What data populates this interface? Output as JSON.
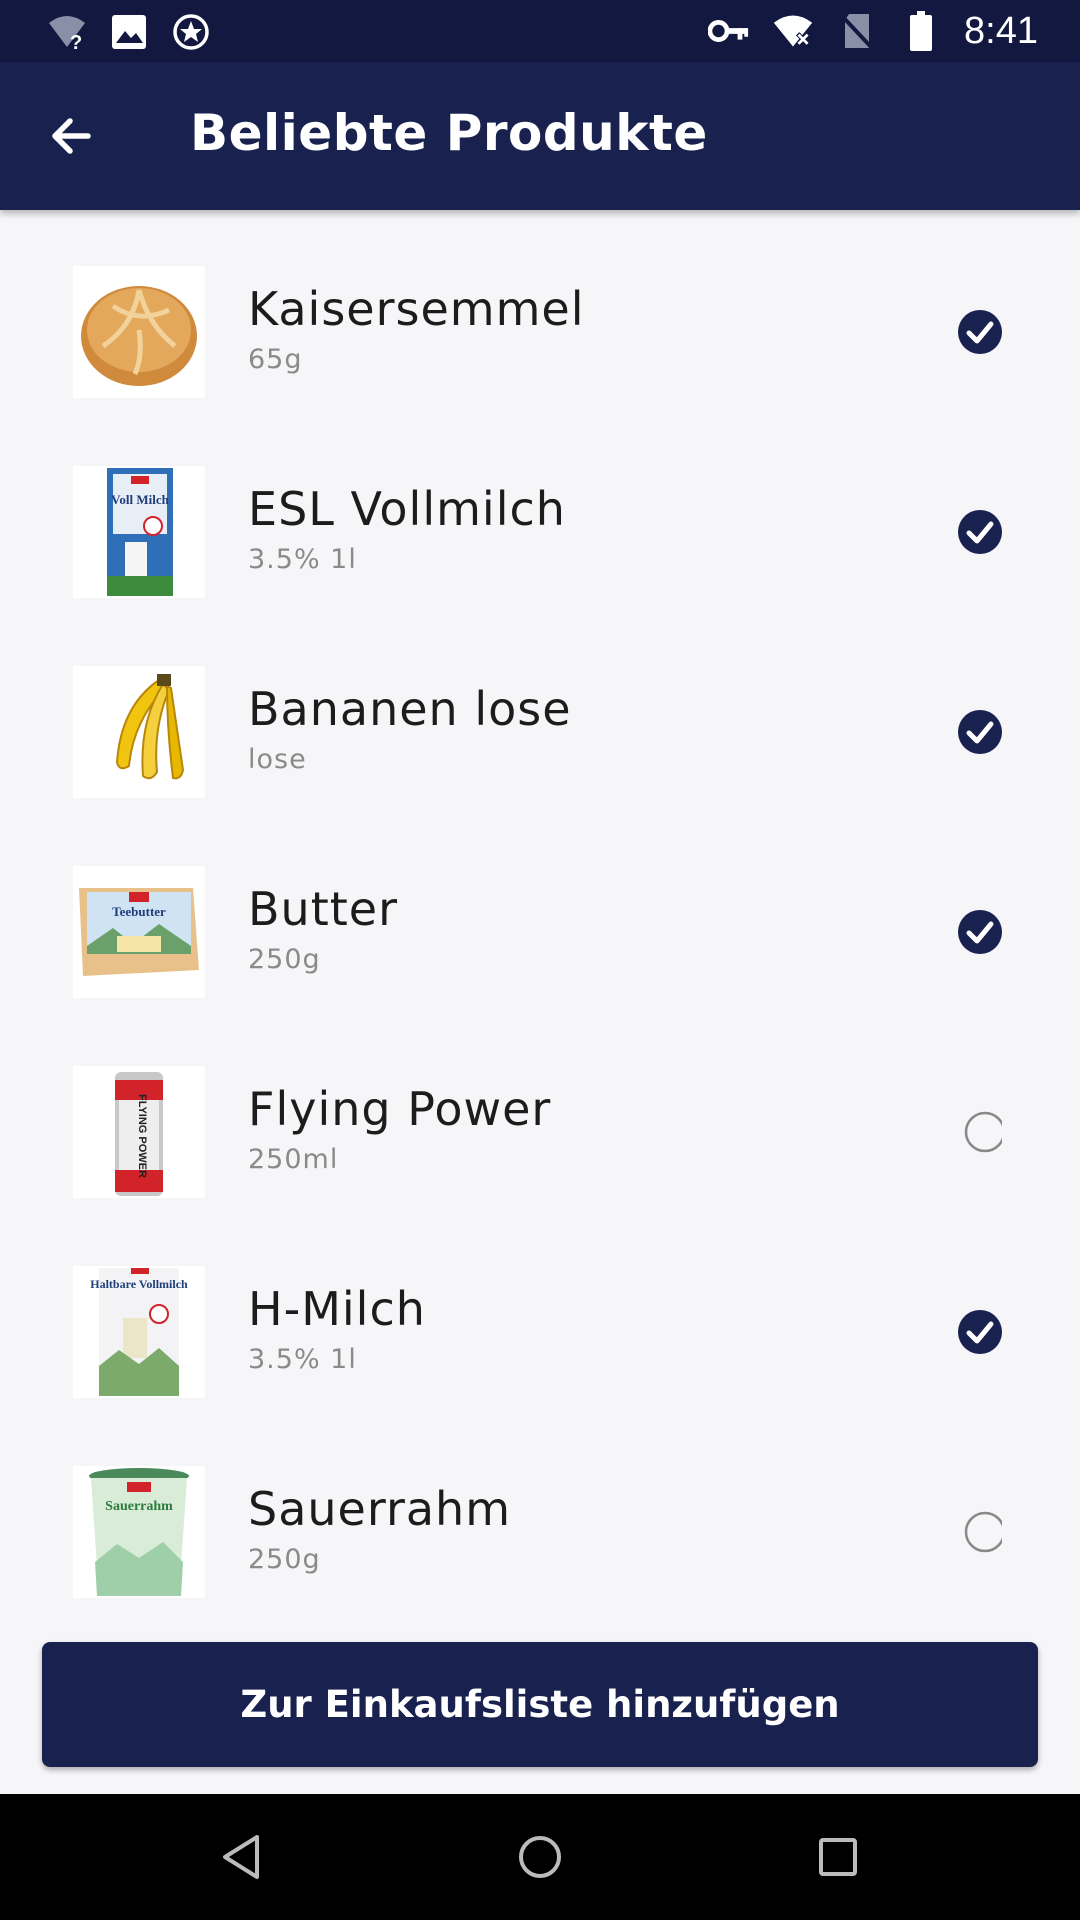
{
  "status_bar": {
    "time": "8:41",
    "left_icons": [
      "wifi-unknown-icon",
      "image-icon",
      "star-badge-icon"
    ],
    "right_icons": [
      "key-icon",
      "wifi-icon",
      "no-sim-icon",
      "battery-icon"
    ]
  },
  "app_bar": {
    "title": "Beliebte Produkte",
    "back_icon": "arrow-left-icon"
  },
  "products": [
    {
      "name": "Kaisersemmel",
      "detail": "65g",
      "selected": true,
      "image": "bread-roll"
    },
    {
      "name": "ESL Vollmilch",
      "detail": "3.5% 1l",
      "selected": true,
      "image": "milk-carton"
    },
    {
      "name": "Bananen lose",
      "detail": "lose",
      "selected": true,
      "image": "bananas"
    },
    {
      "name": "Butter",
      "detail": "250g",
      "selected": true,
      "image": "butter-pack"
    },
    {
      "name": "Flying Power",
      "detail": "250ml",
      "selected": false,
      "image": "energy-can"
    },
    {
      "name": "H-Milch",
      "detail": "3.5% 1l",
      "selected": true,
      "image": "milk-carton-2"
    },
    {
      "name": "Sauerrahm",
      "detail": "250g",
      "selected": false,
      "image": "sour-cream-cup"
    }
  ],
  "product_image_text": {
    "milk": "Voll Milch",
    "butter": "Teebutter",
    "can": "FLYING POWER",
    "hmilch": "Haltbare Vollmilch",
    "sauerrahm": "Sauerrahm"
  },
  "cta": {
    "label": "Zur Einkaufsliste hinzufügen"
  },
  "nav_bar": {
    "icons": [
      "back-triangle-icon",
      "home-circle-icon",
      "recents-square-icon"
    ]
  },
  "colors": {
    "primary": "#19214f",
    "status_bar": "#12183f",
    "check": "#19214f",
    "background": "#f6f6f8"
  }
}
